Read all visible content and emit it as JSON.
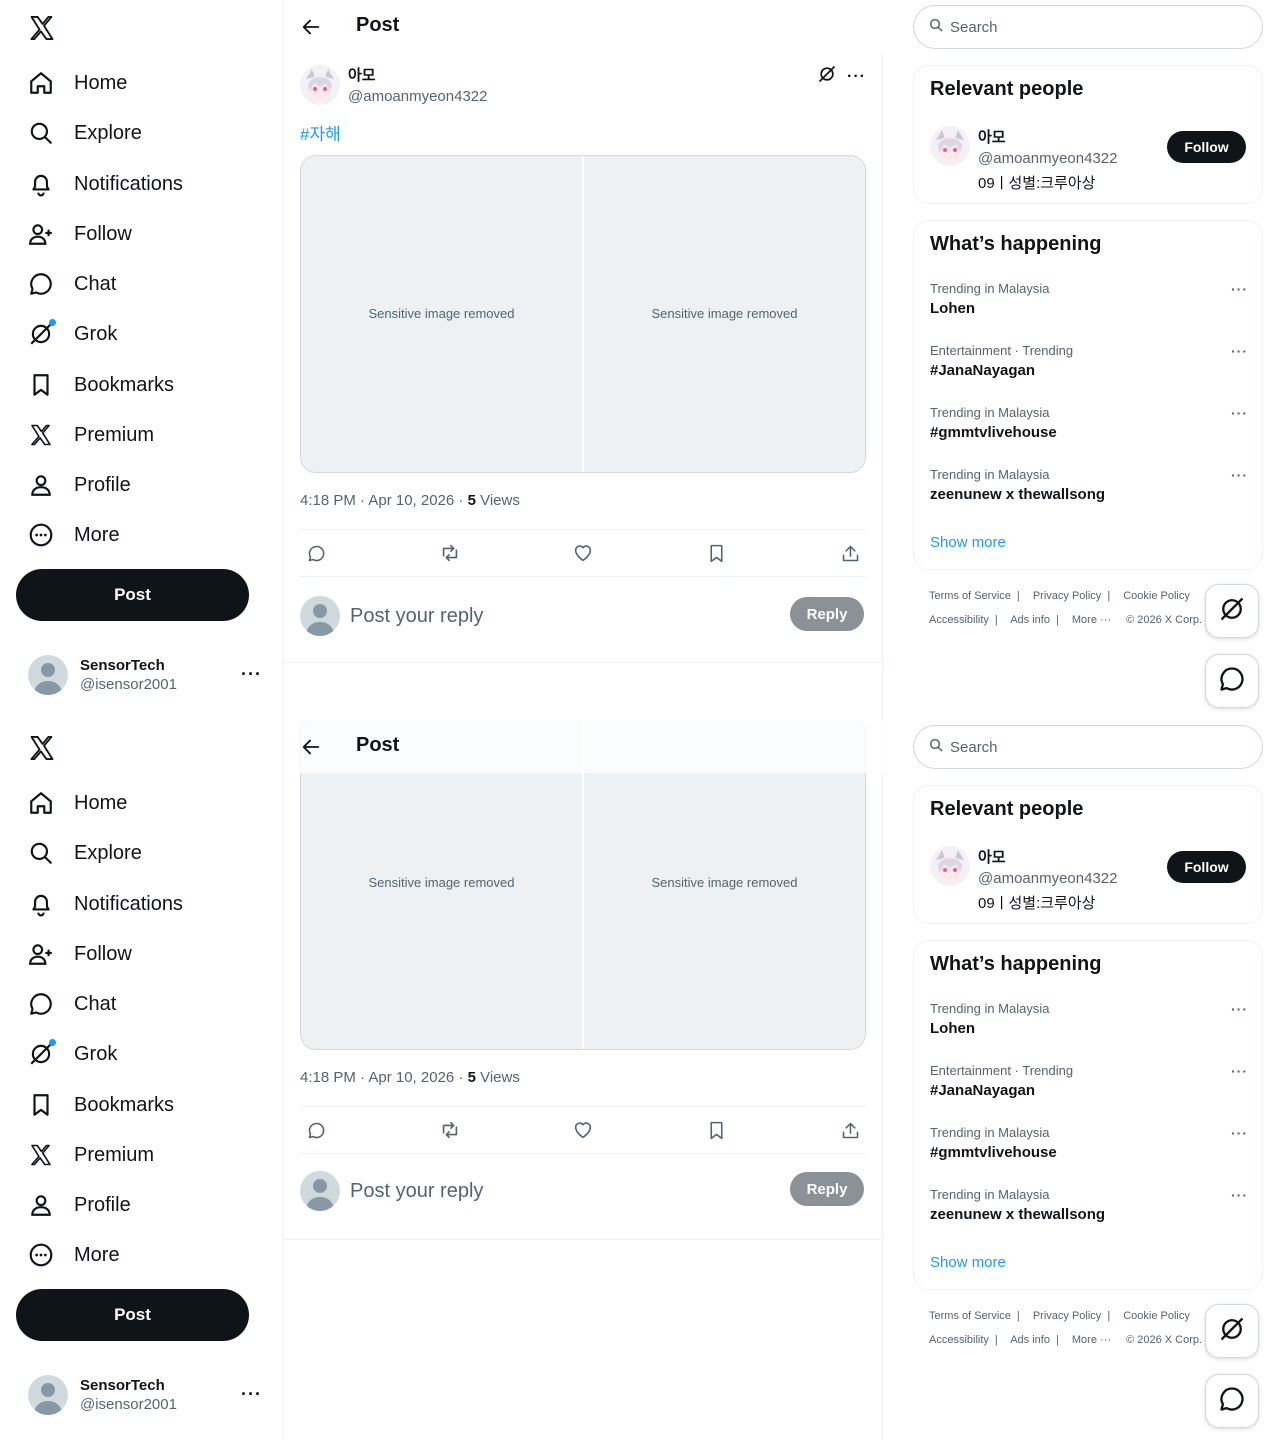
{
  "sidebar": {
    "items": [
      {
        "label": "Home",
        "icon": "home-icon"
      },
      {
        "label": "Explore",
        "icon": "search-icon"
      },
      {
        "label": "Notifications",
        "icon": "bell-icon"
      },
      {
        "label": "Follow",
        "icon": "person-plus-icon"
      },
      {
        "label": "Chat",
        "icon": "chat-icon"
      },
      {
        "label": "Grok",
        "icon": "grok-icon"
      },
      {
        "label": "Bookmarks",
        "icon": "bookmark-icon"
      },
      {
        "label": "Premium",
        "icon": "x-logo-icon"
      },
      {
        "label": "Profile",
        "icon": "person-icon"
      },
      {
        "label": "More",
        "icon": "more-circle-icon"
      }
    ],
    "post_label": "Post",
    "account": {
      "name": "SensorTech",
      "handle": "@isensor2001"
    }
  },
  "main": {
    "header_title": "Post",
    "post": {
      "author_name": "아모",
      "author_handle": "@amoanmyeon4322",
      "hashtag": "#자해",
      "images": [
        "self-harm-wound-photo",
        "blood-stained-cloth-photo"
      ],
      "image_notice": "Sensitive image removed",
      "time": "4:18 PM · Apr 10, 2026 · ",
      "views_count": "5",
      "views_label": " Views"
    },
    "reply_placeholder": "Post your reply",
    "reply_label": "Reply"
  },
  "right": {
    "search_placeholder": "Search",
    "relevant": {
      "title": "Relevant people",
      "name": "아모",
      "handle": "@amoanmyeon4322",
      "bio": "09ㅣ성별:크루아상",
      "follow_label": "Follow"
    },
    "happening": {
      "title": "What’s happening",
      "trends": [
        {
          "context": "Trending in Malaysia",
          "name": "Lohen"
        },
        {
          "context": "Entertainment · Trending",
          "name": "#JanaNayagan"
        },
        {
          "context": "Trending in Malaysia",
          "name": "#gmmtvlivehouse"
        },
        {
          "context": "Trending in Malaysia",
          "name": "zeenunew x thewallsong"
        }
      ],
      "show_more": "Show more"
    },
    "footer": {
      "terms": "Terms of Service",
      "privacy": "Privacy Policy",
      "cookie": "Cookie Policy",
      "accessibility": "Accessibility",
      "ads": "Ads info",
      "more": "More ···",
      "copyright": "© 2026 X Corp."
    }
  },
  "colors": {
    "accent": "#1d9bf0",
    "text": "#0f1419",
    "muted": "#536471",
    "border": "#eff3f4"
  }
}
